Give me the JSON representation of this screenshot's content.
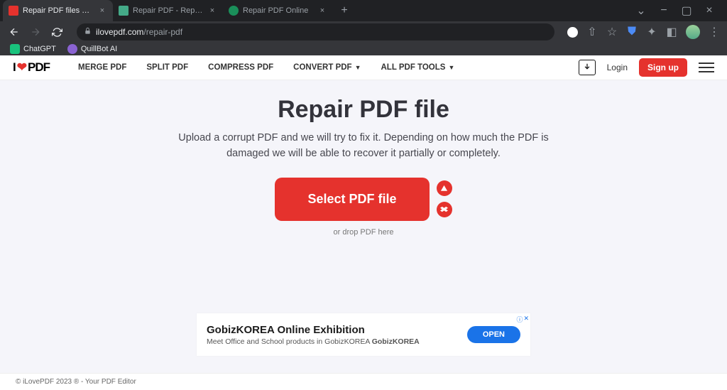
{
  "browser": {
    "tabs": [
      {
        "title": "Repair PDF files online. Free too",
        "active": true,
        "icon_color": "#e5322d"
      },
      {
        "title": "Repair PDF - Repair PDF online f",
        "active": false,
        "icon_color": "#4a8"
      },
      {
        "title": "Repair PDF Online",
        "active": false,
        "icon_color": "#1a8f5a"
      }
    ],
    "url_domain": "ilovepdf.com",
    "url_path": "/repair-pdf",
    "bookmarks": [
      {
        "label": "ChatGPT"
      },
      {
        "label": "QuillBot AI"
      }
    ]
  },
  "header": {
    "logo_i": "I",
    "logo_pdf": "PDF",
    "nav": [
      {
        "label": "MERGE PDF",
        "dropdown": false
      },
      {
        "label": "SPLIT PDF",
        "dropdown": false
      },
      {
        "label": "COMPRESS PDF",
        "dropdown": false
      },
      {
        "label": "CONVERT PDF",
        "dropdown": true
      },
      {
        "label": "ALL PDF TOOLS",
        "dropdown": true
      }
    ],
    "login": "Login",
    "signup": "Sign up"
  },
  "main": {
    "title": "Repair PDF file",
    "subtitle": "Upload a corrupt PDF and we will try to fix it. Depending on how much the PDF is damaged we will be able to recover it partially or completely.",
    "select_button": "Select PDF file",
    "drop_text": "or drop PDF here"
  },
  "ad": {
    "title": "GobizKOREA Online Exhibition",
    "desc_prefix": "Meet Office and School products in GobizKOREA ",
    "desc_bold": "GobizKOREA",
    "cta": "OPEN"
  },
  "footer": {
    "text": "© iLovePDF 2023 ® - Your PDF Editor"
  }
}
